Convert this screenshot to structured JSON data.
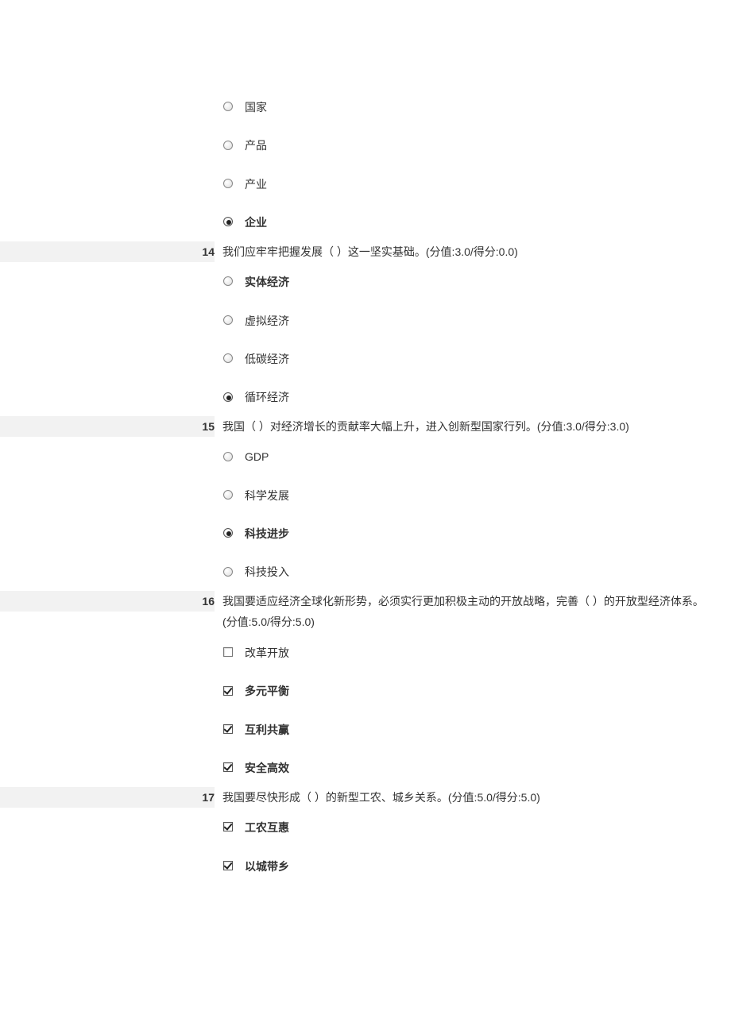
{
  "questions": [
    {
      "num": "",
      "text": "",
      "type": "radio",
      "shade": false,
      "options": [
        {
          "label": "国家",
          "selected": false,
          "bold": false
        },
        {
          "label": "产品",
          "selected": false,
          "bold": false
        },
        {
          "label": "产业",
          "selected": false,
          "bold": false
        },
        {
          "label": "企业",
          "selected": true,
          "bold": true
        }
      ]
    },
    {
      "num": "14",
      "text": "我们应牢牢把握发展（ ）这一坚实基础。(分值:3.0/得分:0.0)",
      "type": "radio",
      "shade": true,
      "options": [
        {
          "label": "实体经济",
          "selected": false,
          "bold": true
        },
        {
          "label": "虚拟经济",
          "selected": false,
          "bold": false
        },
        {
          "label": "低碳经济",
          "selected": false,
          "bold": false
        },
        {
          "label": "循环经济",
          "selected": true,
          "bold": false
        }
      ]
    },
    {
      "num": "15",
      "text": "我国（ ）对经济增长的贡献率大幅上升，进入创新型国家行列。(分值:3.0/得分:3.0)",
      "type": "radio",
      "shade": true,
      "options": [
        {
          "label": "GDP",
          "selected": false,
          "bold": false
        },
        {
          "label": "科学发展",
          "selected": false,
          "bold": false
        },
        {
          "label": "科技进步",
          "selected": true,
          "bold": true
        },
        {
          "label": "科技投入",
          "selected": false,
          "bold": false
        }
      ]
    },
    {
      "num": "16",
      "text": "我国要适应经济全球化新形势，必须实行更加积极主动的开放战略，完善（ ）的开放型经济体系。(分值:5.0/得分:5.0)",
      "type": "checkbox",
      "shade": true,
      "options": [
        {
          "label": "改革开放",
          "selected": false,
          "bold": false
        },
        {
          "label": "多元平衡",
          "selected": true,
          "bold": true
        },
        {
          "label": "互利共赢",
          "selected": true,
          "bold": true
        },
        {
          "label": "安全高效",
          "selected": true,
          "bold": true
        }
      ]
    },
    {
      "num": "17",
      "text": "我国要尽快形成（ ）的新型工农、城乡关系。(分值:5.0/得分:5.0)",
      "type": "checkbox",
      "shade": true,
      "options": [
        {
          "label": "工农互惠",
          "selected": true,
          "bold": true
        },
        {
          "label": "以城带乡",
          "selected": true,
          "bold": true
        }
      ]
    }
  ]
}
